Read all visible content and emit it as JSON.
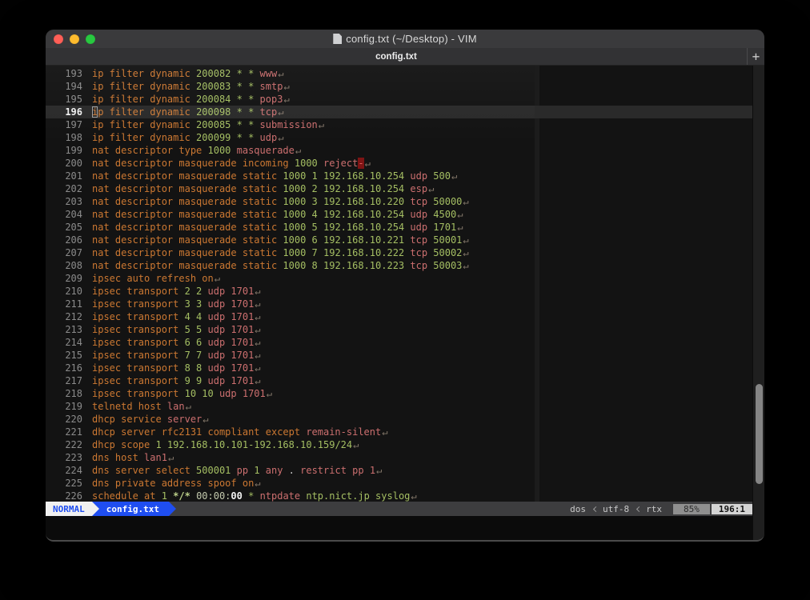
{
  "window": {
    "title": "config.txt (~/Desktop) - VIM"
  },
  "tabbar": {
    "tab_label": "config.txt",
    "new_tab_label": "+"
  },
  "colors": {
    "o": "#cc7832",
    "g": "#a5bf63",
    "p": "#cc6f6f",
    "w": "#c9c9c9",
    "pb": "#c3c9ad",
    "wb": "#f2f2f2",
    "gb": "#bcd08a",
    "rb": "#e05c5c",
    "rbbg": "#7e1414",
    "eol": "#85786b",
    "lnum": "#8b8b8b",
    "lnumcur": "#f0f0f0",
    "accent": "#1f4ef0",
    "traffic_red": "#ff5f57",
    "traffic_yellow": "#febc2e",
    "traffic_green": "#28c840"
  },
  "editor": {
    "current_line": 196,
    "eol_char": "↵",
    "lines": [
      {
        "num": 193,
        "segments": [
          [
            "o",
            "ip filter dynamic "
          ],
          [
            "g",
            "200082 * * "
          ],
          [
            "p",
            "www"
          ]
        ]
      },
      {
        "num": 194,
        "segments": [
          [
            "o",
            "ip filter dynamic "
          ],
          [
            "g",
            "200083 * * "
          ],
          [
            "p",
            "smtp"
          ]
        ]
      },
      {
        "num": 195,
        "segments": [
          [
            "o",
            "ip filter dynamic "
          ],
          [
            "g",
            "200084 * * "
          ],
          [
            "p",
            "pop3"
          ]
        ]
      },
      {
        "num": 196,
        "segments": [
          [
            "cur",
            "i"
          ],
          [
            "o",
            "p filter dynamic "
          ],
          [
            "g",
            "200098 * * "
          ],
          [
            "p",
            "tcp"
          ]
        ]
      },
      {
        "num": 197,
        "segments": [
          [
            "o",
            "ip filter dynamic "
          ],
          [
            "g",
            "200085 * * "
          ],
          [
            "p",
            "submission"
          ]
        ]
      },
      {
        "num": 198,
        "segments": [
          [
            "o",
            "ip filter dynamic "
          ],
          [
            "g",
            "200099 * * "
          ],
          [
            "p",
            "udp"
          ]
        ]
      },
      {
        "num": 199,
        "segments": [
          [
            "o",
            "nat descriptor type "
          ],
          [
            "g",
            "1000 "
          ],
          [
            "p",
            "masquerade"
          ]
        ]
      },
      {
        "num": 200,
        "segments": [
          [
            "o",
            "nat descriptor masquerade incoming "
          ],
          [
            "g",
            "1000 "
          ],
          [
            "p",
            "reject"
          ],
          [
            "rb",
            "-"
          ]
        ]
      },
      {
        "num": 201,
        "segments": [
          [
            "o",
            "nat descriptor masquerade static "
          ],
          [
            "g",
            "1000 1 192.168.10.254 "
          ],
          [
            "p",
            "udp "
          ],
          [
            "g",
            "500"
          ]
        ]
      },
      {
        "num": 202,
        "segments": [
          [
            "o",
            "nat descriptor masquerade static "
          ],
          [
            "g",
            "1000 2 192.168.10.254 "
          ],
          [
            "p",
            "esp"
          ]
        ]
      },
      {
        "num": 203,
        "segments": [
          [
            "o",
            "nat descriptor masquerade static "
          ],
          [
            "g",
            "1000 3 192.168.10.220 "
          ],
          [
            "p",
            "tcp "
          ],
          [
            "g",
            "50000"
          ]
        ]
      },
      {
        "num": 204,
        "segments": [
          [
            "o",
            "nat descriptor masquerade static "
          ],
          [
            "g",
            "1000 4 192.168.10.254 "
          ],
          [
            "p",
            "udp "
          ],
          [
            "g",
            "4500"
          ]
        ]
      },
      {
        "num": 205,
        "segments": [
          [
            "o",
            "nat descriptor masquerade static "
          ],
          [
            "g",
            "1000 5 192.168.10.254 "
          ],
          [
            "p",
            "udp "
          ],
          [
            "g",
            "1701"
          ]
        ]
      },
      {
        "num": 206,
        "segments": [
          [
            "o",
            "nat descriptor masquerade static "
          ],
          [
            "g",
            "1000 6 192.168.10.221 "
          ],
          [
            "p",
            "tcp "
          ],
          [
            "g",
            "50001"
          ]
        ]
      },
      {
        "num": 207,
        "segments": [
          [
            "o",
            "nat descriptor masquerade static "
          ],
          [
            "g",
            "1000 7 192.168.10.222 "
          ],
          [
            "p",
            "tcp "
          ],
          [
            "g",
            "50002"
          ]
        ]
      },
      {
        "num": 208,
        "segments": [
          [
            "o",
            "nat descriptor masquerade static "
          ],
          [
            "g",
            "1000 8 192.168.10.223 "
          ],
          [
            "p",
            "tcp "
          ],
          [
            "g",
            "50003"
          ]
        ]
      },
      {
        "num": 209,
        "segments": [
          [
            "o",
            "ipsec auto refresh on"
          ]
        ]
      },
      {
        "num": 210,
        "segments": [
          [
            "o",
            "ipsec transport "
          ],
          [
            "g",
            "2 2 "
          ],
          [
            "p",
            "udp 1701"
          ]
        ]
      },
      {
        "num": 211,
        "segments": [
          [
            "o",
            "ipsec transport "
          ],
          [
            "g",
            "3 3 "
          ],
          [
            "p",
            "udp 1701"
          ]
        ]
      },
      {
        "num": 212,
        "segments": [
          [
            "o",
            "ipsec transport "
          ],
          [
            "g",
            "4 4 "
          ],
          [
            "p",
            "udp 1701"
          ]
        ]
      },
      {
        "num": 213,
        "segments": [
          [
            "o",
            "ipsec transport "
          ],
          [
            "g",
            "5 5 "
          ],
          [
            "p",
            "udp 1701"
          ]
        ]
      },
      {
        "num": 214,
        "segments": [
          [
            "o",
            "ipsec transport "
          ],
          [
            "g",
            "6 6 "
          ],
          [
            "p",
            "udp 1701"
          ]
        ]
      },
      {
        "num": 215,
        "segments": [
          [
            "o",
            "ipsec transport "
          ],
          [
            "g",
            "7 7 "
          ],
          [
            "p",
            "udp 1701"
          ]
        ]
      },
      {
        "num": 216,
        "segments": [
          [
            "o",
            "ipsec transport "
          ],
          [
            "g",
            "8 8 "
          ],
          [
            "p",
            "udp 1701"
          ]
        ]
      },
      {
        "num": 217,
        "segments": [
          [
            "o",
            "ipsec transport "
          ],
          [
            "g",
            "9 9 "
          ],
          [
            "p",
            "udp 1701"
          ]
        ]
      },
      {
        "num": 218,
        "segments": [
          [
            "o",
            "ipsec transport "
          ],
          [
            "g",
            "10 10 "
          ],
          [
            "p",
            "udp 1701"
          ]
        ]
      },
      {
        "num": 219,
        "segments": [
          [
            "o",
            "telnetd host "
          ],
          [
            "p",
            "lan"
          ]
        ]
      },
      {
        "num": 220,
        "segments": [
          [
            "o",
            "dhcp service "
          ],
          [
            "p",
            "server"
          ]
        ]
      },
      {
        "num": 221,
        "segments": [
          [
            "o",
            "dhcp server rfc2131 compliant except "
          ],
          [
            "p",
            "remain-silent"
          ]
        ]
      },
      {
        "num": 222,
        "segments": [
          [
            "o",
            "dhcp scope "
          ],
          [
            "g",
            "1 192.168.10.101-192.168.10.159/24"
          ]
        ]
      },
      {
        "num": 223,
        "segments": [
          [
            "o",
            "dns host "
          ],
          [
            "p",
            "lan1"
          ]
        ]
      },
      {
        "num": 224,
        "segments": [
          [
            "o",
            "dns server select "
          ],
          [
            "g",
            "500001 "
          ],
          [
            "p",
            "pp "
          ],
          [
            "g",
            "1 "
          ],
          [
            "p",
            "any "
          ],
          [
            "w",
            ". "
          ],
          [
            "p",
            "restrict pp 1"
          ]
        ]
      },
      {
        "num": 225,
        "segments": [
          [
            "o",
            "dns private address spoof on"
          ]
        ]
      },
      {
        "num": 226,
        "segments": [
          [
            "o",
            "schedule at "
          ],
          [
            "g",
            "1 "
          ],
          [
            "gb",
            "*/* "
          ],
          [
            "pb",
            "00:00:"
          ],
          [
            "wb",
            "00"
          ],
          [
            "g",
            " * "
          ],
          [
            "p",
            "ntpdate "
          ],
          [
            "g",
            "ntp.nict.jp syslog"
          ]
        ]
      }
    ]
  },
  "statusline": {
    "mode": "NORMAL",
    "filename": "config.txt",
    "fileformat": "dos",
    "encoding": "utf-8",
    "filetype": "rtx",
    "separator_icon": "chevron-left",
    "scroll_percent": "85%",
    "cursor_position": "196:1"
  }
}
